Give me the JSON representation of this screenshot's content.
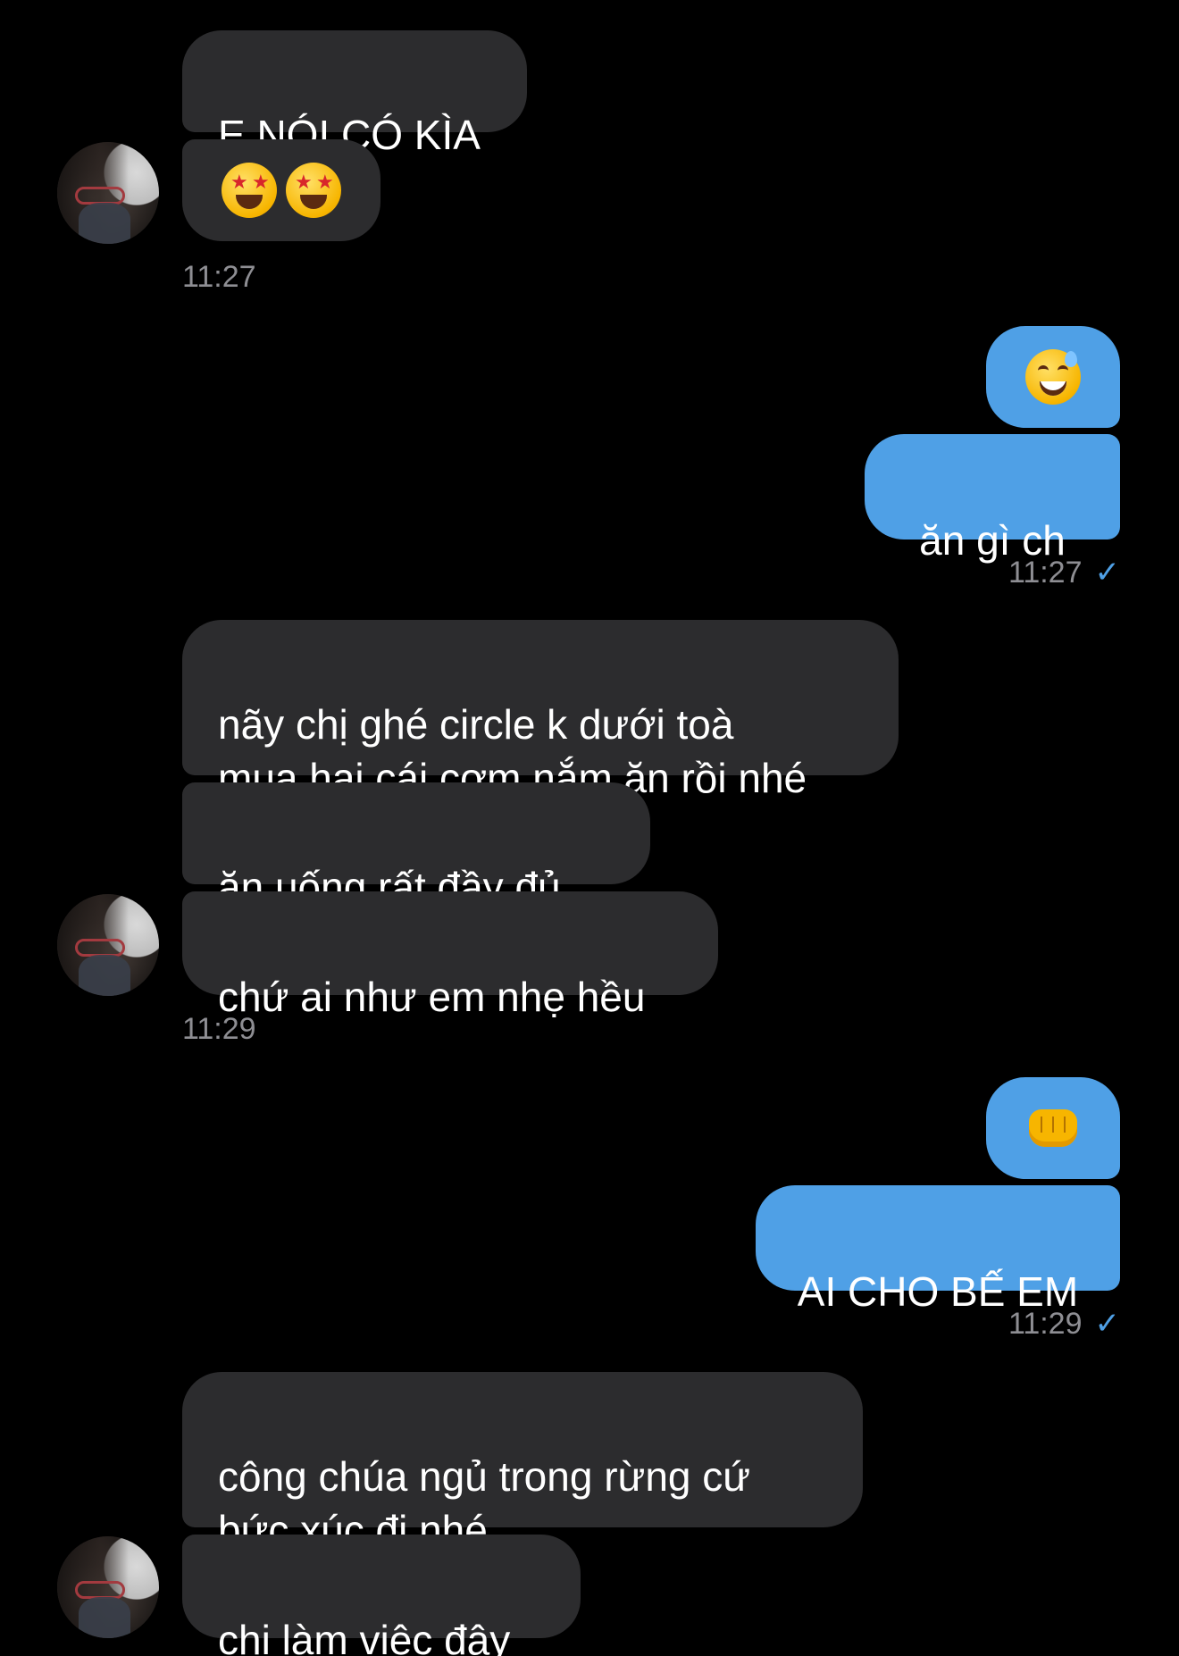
{
  "colors": {
    "background": "#000000",
    "incoming_bubble": "#2c2c2e",
    "outgoing_bubble": "#4fa0e6",
    "timestamp": "#8e8e93",
    "read_check": "#4fa0e6"
  },
  "groups": [
    {
      "side": "incoming",
      "messages": [
        {
          "type": "text",
          "text": "E NÓI CÓ KÌA"
        },
        {
          "type": "emoji",
          "emoji": [
            "star-struck-face",
            "star-struck-face"
          ]
        }
      ],
      "time": "11:27"
    },
    {
      "side": "outgoing",
      "messages": [
        {
          "type": "emoji",
          "emoji": [
            "grinning-sweat-face"
          ]
        },
        {
          "type": "text",
          "text": "ăn gì ch"
        }
      ],
      "time": "11:27",
      "read_mark": "✓"
    },
    {
      "side": "incoming",
      "messages": [
        {
          "type": "text",
          "text": "nãy chị ghé circle k dưới toà\nmua hai cái cơm nắm ăn rồi nhé"
        },
        {
          "type": "text",
          "text": "ăn uống rất đầy đủ"
        },
        {
          "type": "text",
          "text": "chứ ai như em nhẹ hều"
        }
      ],
      "time": "11:29"
    },
    {
      "side": "outgoing",
      "messages": [
        {
          "type": "emoji",
          "emoji": [
            "oncoming-fist"
          ]
        },
        {
          "type": "text",
          "text": "AI CHO BẾ EM"
        }
      ],
      "time": "11:29",
      "read_mark": "✓"
    },
    {
      "side": "incoming",
      "messages": [
        {
          "type": "text",
          "text": "công chúa ngủ trong rừng cứ\nbức xúc đi nhé"
        },
        {
          "type": "text",
          "text": "chị làm việc đây"
        }
      ]
    }
  ]
}
